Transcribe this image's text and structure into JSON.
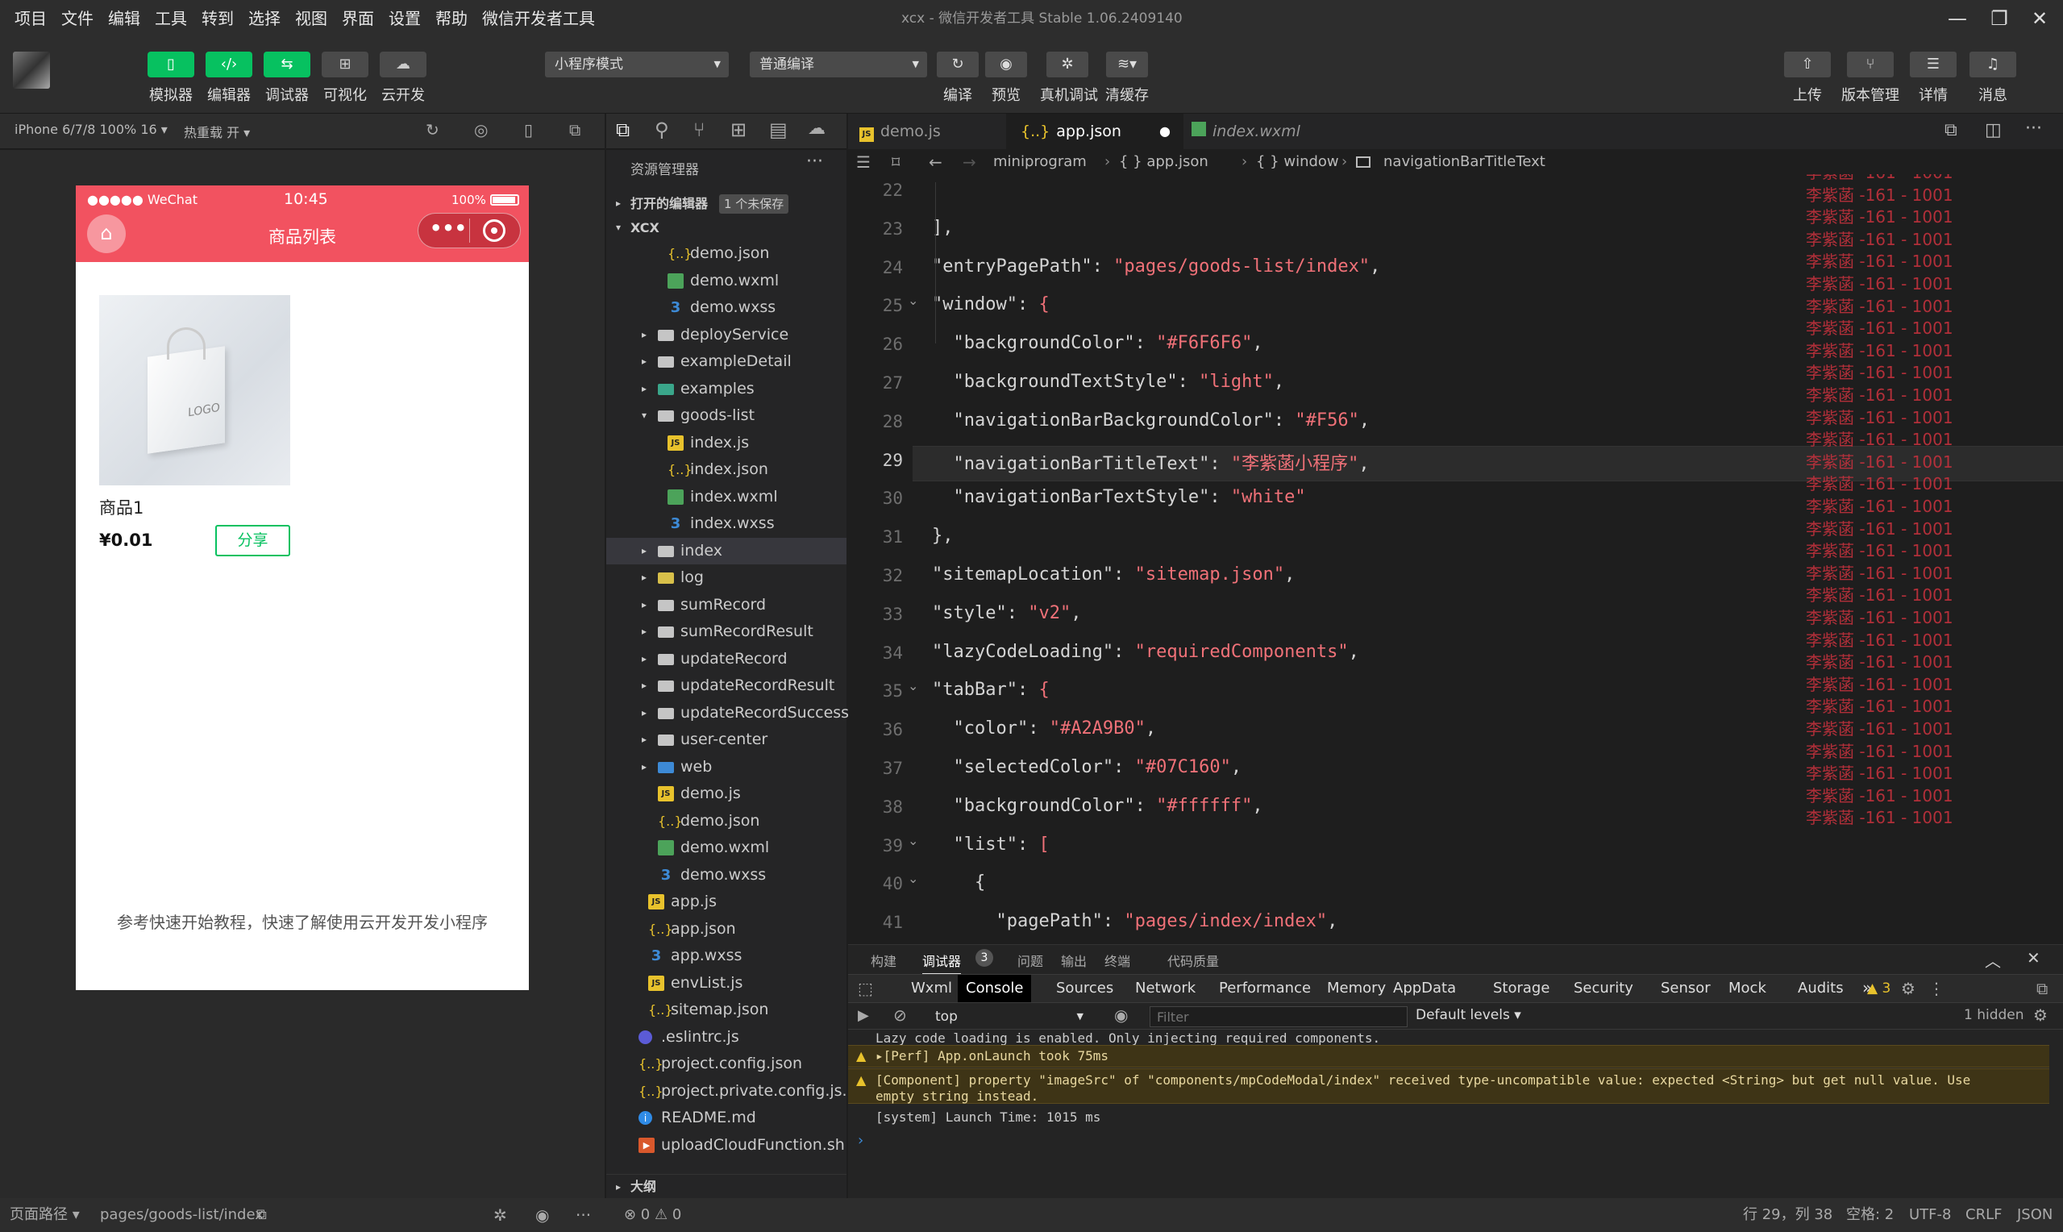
{
  "menu": [
    "项目",
    "文件",
    "编辑",
    "工具",
    "转到",
    "选择",
    "视图",
    "界面",
    "设置",
    "帮助",
    "微信开发者工具"
  ],
  "window_title": "xcx - 微信开发者工具 Stable 1.06.2409140",
  "toolbar": {
    "left_buttons": [
      "模拟器",
      "编辑器",
      "调试器",
      "可视化",
      "云开发"
    ],
    "mode_select": "小程序模式",
    "compile_select": "普通编译",
    "mid_buttons": [
      "编译",
      "预览",
      "真机调试",
      "清缓存"
    ],
    "right_buttons": [
      "上传",
      "版本管理",
      "详情",
      "消息"
    ]
  },
  "simulator": {
    "device": "iPhone 6/7/8 100% 16",
    "hot_reload": "热重载 开",
    "status_carrier": "●●●●● WeChat",
    "status_time": "10:45",
    "status_battery": "100%",
    "nav_title": "商品列表",
    "product_name": "商品1",
    "product_price": "¥0.01",
    "share_button": "分享",
    "footer_tip": "参考快速开始教程，快速了解使用云开发开发小程序",
    "logo_text": "LOGO"
  },
  "explorer": {
    "title": "资源管理器",
    "open_editors": "打开的编辑器",
    "unsaved_badge": "1 个未保存",
    "root": "XCX",
    "outline": "大纲",
    "items": [
      {
        "name": "demo.json",
        "type": "json",
        "indent": 2
      },
      {
        "name": "demo.wxml",
        "type": "wxml",
        "indent": 2
      },
      {
        "name": "demo.wxss",
        "type": "wxss",
        "indent": 2
      },
      {
        "name": "deployService",
        "type": "folder",
        "indent": 1,
        "arrow": "▸"
      },
      {
        "name": "exampleDetail",
        "type": "folder",
        "indent": 1,
        "arrow": "▸"
      },
      {
        "name": "examples",
        "type": "folder-teal",
        "indent": 1,
        "arrow": "▸"
      },
      {
        "name": "goods-list",
        "type": "folder",
        "indent": 1,
        "arrow": "▾"
      },
      {
        "name": "index.js",
        "type": "js",
        "indent": 2
      },
      {
        "name": "index.json",
        "type": "json",
        "indent": 2
      },
      {
        "name": "index.wxml",
        "type": "wxml",
        "indent": 2
      },
      {
        "name": "index.wxss",
        "type": "wxss",
        "indent": 2
      },
      {
        "name": "index",
        "type": "folder",
        "indent": 1,
        "arrow": "▸",
        "hl": true
      },
      {
        "name": "log",
        "type": "folder-yellow",
        "indent": 1,
        "arrow": "▸"
      },
      {
        "name": "sumRecord",
        "type": "folder",
        "indent": 1,
        "arrow": "▸"
      },
      {
        "name": "sumRecordResult",
        "type": "folder",
        "indent": 1,
        "arrow": "▸"
      },
      {
        "name": "updateRecord",
        "type": "folder",
        "indent": 1,
        "arrow": "▸"
      },
      {
        "name": "updateRecordResult",
        "type": "folder",
        "indent": 1,
        "arrow": "▸"
      },
      {
        "name": "updateRecordSuccess",
        "type": "folder",
        "indent": 1,
        "arrow": "▸"
      },
      {
        "name": "user-center",
        "type": "folder",
        "indent": 1,
        "arrow": "▸"
      },
      {
        "name": "web",
        "type": "folder-blue",
        "indent": 1,
        "arrow": "▸"
      },
      {
        "name": "demo.js",
        "type": "js",
        "indent": 1
      },
      {
        "name": "demo.json",
        "type": "json",
        "indent": 1
      },
      {
        "name": "demo.wxml",
        "type": "wxml",
        "indent": 1
      },
      {
        "name": "demo.wxss",
        "type": "wxss",
        "indent": 1
      },
      {
        "name": "app.js",
        "type": "js",
        "indent": 0
      },
      {
        "name": "app.json",
        "type": "json",
        "indent": 0
      },
      {
        "name": "app.wxss",
        "type": "wxss",
        "indent": 0
      },
      {
        "name": "envList.js",
        "type": "js",
        "indent": 0
      },
      {
        "name": "sitemap.json",
        "type": "json",
        "indent": 0
      },
      {
        "name": ".eslintrc.js",
        "type": "dot",
        "indent": -1
      },
      {
        "name": "project.config.json",
        "type": "json",
        "indent": -1
      },
      {
        "name": "project.private.config.js...",
        "type": "json",
        "indent": -1
      },
      {
        "name": "README.md",
        "type": "info",
        "indent": -1
      },
      {
        "name": "uploadCloudFunction.sh",
        "type": "sh",
        "indent": -1
      }
    ]
  },
  "editor": {
    "tabs": [
      "demo.js",
      "app.json",
      "index.wxml"
    ],
    "breadcrumb": [
      "miniprogram",
      "{ } app.json",
      "{ } window",
      "navigationBarTitleText"
    ],
    "lines": [
      {
        "n": "22",
        "t": ""
      },
      {
        "n": "23",
        "t": "],"
      },
      {
        "n": "24",
        "t": "\"entryPagePath\": \"pages/goods-list/index\","
      },
      {
        "n": "25",
        "t": "\"window\": {"
      },
      {
        "n": "26",
        "t": "  \"backgroundColor\": \"#F6F6F6\","
      },
      {
        "n": "27",
        "t": "  \"backgroundTextStyle\": \"light\","
      },
      {
        "n": "28",
        "t": "  \"navigationBarBackgroundColor\": \"#F56\","
      },
      {
        "n": "29",
        "t": "  \"navigationBarTitleText\": \"李紫菡小程序\","
      },
      {
        "n": "30",
        "t": "  \"navigationBarTextStyle\": \"white\""
      },
      {
        "n": "31",
        "t": "},"
      },
      {
        "n": "32",
        "t": "\"sitemapLocation\": \"sitemap.json\","
      },
      {
        "n": "33",
        "t": "\"style\": \"v2\","
      },
      {
        "n": "34",
        "t": "\"lazyCodeLoading\": \"requiredComponents\","
      },
      {
        "n": "35",
        "t": "\"tabBar\": {"
      },
      {
        "n": "36",
        "t": "  \"color\": \"#A2A9B0\","
      },
      {
        "n": "37",
        "t": "  \"selectedColor\": \"#07C160\","
      },
      {
        "n": "38",
        "t": "  \"backgroundColor\": \"#ffffff\","
      },
      {
        "n": "39",
        "t": "  \"list\": ["
      },
      {
        "n": "40",
        "t": "    {"
      },
      {
        "n": "41",
        "t": "      \"pagePath\": \"pages/index/index\","
      }
    ],
    "watermark": "李紫菡 -161 - 1001"
  },
  "devtools": {
    "top_tabs": [
      "构建",
      "调试器",
      "问题",
      "输出",
      "终端",
      "代码质量"
    ],
    "debugger_badge": "3",
    "panel_tabs": [
      "Wxml",
      "Console",
      "Sources",
      "Network",
      "Performance",
      "Memory",
      "AppData",
      "Storage",
      "Security",
      "Sensor",
      "Mock",
      "Audits"
    ],
    "warn_count": "3",
    "context": "top",
    "filter_placeholder": "Filter",
    "levels": "Default levels",
    "hidden": "1 hidden",
    "console": [
      "Lazy code loading is enabled. Only injecting required components.",
      "▸[Perf] App.onLaunch took 75ms",
      "[Component] property \"imageSrc\" of \"components/mpCodeModal/index\" received type-uncompatible value: expected <String> but get null value. Use",
      "empty string instead.",
      "[system] Launch Time: 1015 ms"
    ]
  },
  "statusbar": {
    "page_path_label": "页面路径",
    "page_path": "pages/goods-list/index",
    "problems": "⊗ 0 ⚠ 0",
    "position": "行 29，列 38",
    "spaces": "空格: 2",
    "encoding": "UTF-8",
    "eol": "CRLF",
    "lang": "JSON"
  },
  "colors": {
    "accent_green": "#07c160",
    "nav_red": "#f25260",
    "string": "#f07178",
    "watermark": "#c3313d"
  }
}
